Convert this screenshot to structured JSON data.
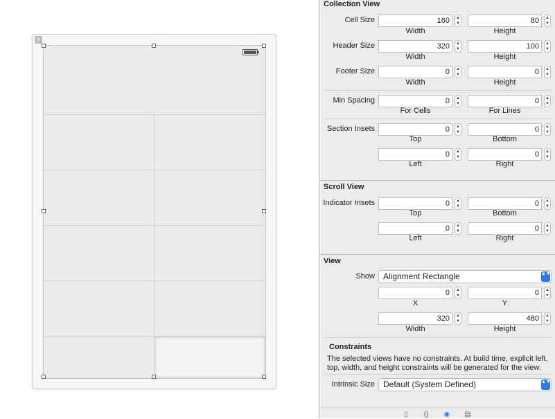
{
  "canvas": {
    "close_glyph": "×",
    "icons": {
      "battery": "battery-icon",
      "close": "close-icon"
    }
  },
  "collection_view": {
    "title": "Collection View",
    "cell_size": {
      "label": "Cell Size",
      "width": "160",
      "height": "80",
      "width_label": "Width",
      "height_label": "Height"
    },
    "header_size": {
      "label": "Header Size",
      "width": "320",
      "height": "100",
      "width_label": "Width",
      "height_label": "Height"
    },
    "footer_size": {
      "label": "Footer Size",
      "width": "0",
      "height": "0",
      "width_label": "Width",
      "height_label": "Height"
    },
    "min_spacing": {
      "label": "Min Spacing",
      "cells": "0",
      "lines": "0",
      "cells_label": "For Cells",
      "lines_label": "For Lines"
    },
    "section_insets": {
      "label": "Section Insets",
      "top": "0",
      "bottom": "0",
      "left": "0",
      "right": "0",
      "top_label": "Top",
      "bottom_label": "Bottom",
      "left_label": "Left",
      "right_label": "Right"
    }
  },
  "scroll_view": {
    "title": "Scroll View",
    "indicator_insets": {
      "label": "Indicator Insets",
      "top": "0",
      "bottom": "0",
      "left": "0",
      "right": "0",
      "top_label": "Top",
      "bottom_label": "Bottom",
      "left_label": "Left",
      "right_label": "Right"
    }
  },
  "view": {
    "title": "View",
    "show_label": "Show",
    "show_value": "Alignment Rectangle",
    "x": "0",
    "y": "0",
    "x_label": "X",
    "y_label": "Y",
    "width": "320",
    "height": "480",
    "width_label": "Width",
    "height_label": "Height"
  },
  "constraints": {
    "title": "Constraints",
    "note": "The selected views have no constraints. At build time, explicit left, top, width, and height constraints will be generated for the view.",
    "intrinsic_label": "Intrinsic Size",
    "intrinsic_value": "Default (System Defined)"
  },
  "stepper": {
    "up": "▲",
    "down": "▼"
  },
  "popup_arrows": "▲▼",
  "inspector_tabs": [
    {
      "name": "file-icon",
      "glyph": "▯"
    },
    {
      "name": "braces-icon",
      "glyph": "{}"
    },
    {
      "name": "target-icon",
      "glyph": "◉"
    },
    {
      "name": "library-icon",
      "glyph": "▤"
    }
  ]
}
